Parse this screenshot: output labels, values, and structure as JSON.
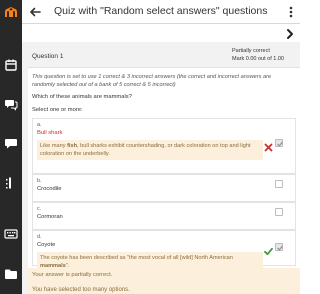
{
  "header": {
    "title": "Quiz with \"Random select answers\" questions"
  },
  "question": {
    "number_label": "Question 1",
    "state": "Partially correct",
    "mark": "Mark 0.00 out of 1.00",
    "intro": "This question is set to use 1 correct & 3 incorrect answers (the correct and incorrect answers are randomly selected out of a bank of 5 correct & 5 incorrect)",
    "prompt": "Which of these animals are mammals?",
    "select_hint": "Select one or more:"
  },
  "options": [
    {
      "letter": "a.",
      "label": "Bull shark",
      "checked": true,
      "result": "wrong",
      "feedback": {
        "before": "Like many ",
        "bold": "fish",
        "after": ", bull sharks exhibit countershading, or dark coloration on top and light coloration on the underbelly."
      }
    },
    {
      "letter": "b.",
      "label": "Crocodile",
      "checked": false
    },
    {
      "letter": "c.",
      "label": "Cormoran",
      "checked": false
    },
    {
      "letter": "d.",
      "label": "Coyote",
      "checked": true,
      "result": "correct",
      "feedback": {
        "before": "The coyote has been described as \"the most vocal of all [wild] North American ",
        "bold": "mammals",
        "after": "\"."
      }
    }
  ],
  "outcome": {
    "partially": "Your answer is partially correct.",
    "too_many": "You have selected too many options."
  },
  "colors": {
    "sidebar_bg": "#282828",
    "brand_orange": "#f98012",
    "wrong_red": "#c9302c",
    "correct_green": "#3c9a3c",
    "feedback_bg": "#fcefdc"
  },
  "icons": {
    "sidebar": [
      "moodle-logo-icon",
      "calendar-icon",
      "chat-icon",
      "messages-icon",
      "menu-icon",
      "keyboard-icon",
      "folder-icon"
    ],
    "header_back": "arrow-left-icon",
    "header_menu": "vertical-ellipsis-icon",
    "next": "chevron-right-icon"
  }
}
